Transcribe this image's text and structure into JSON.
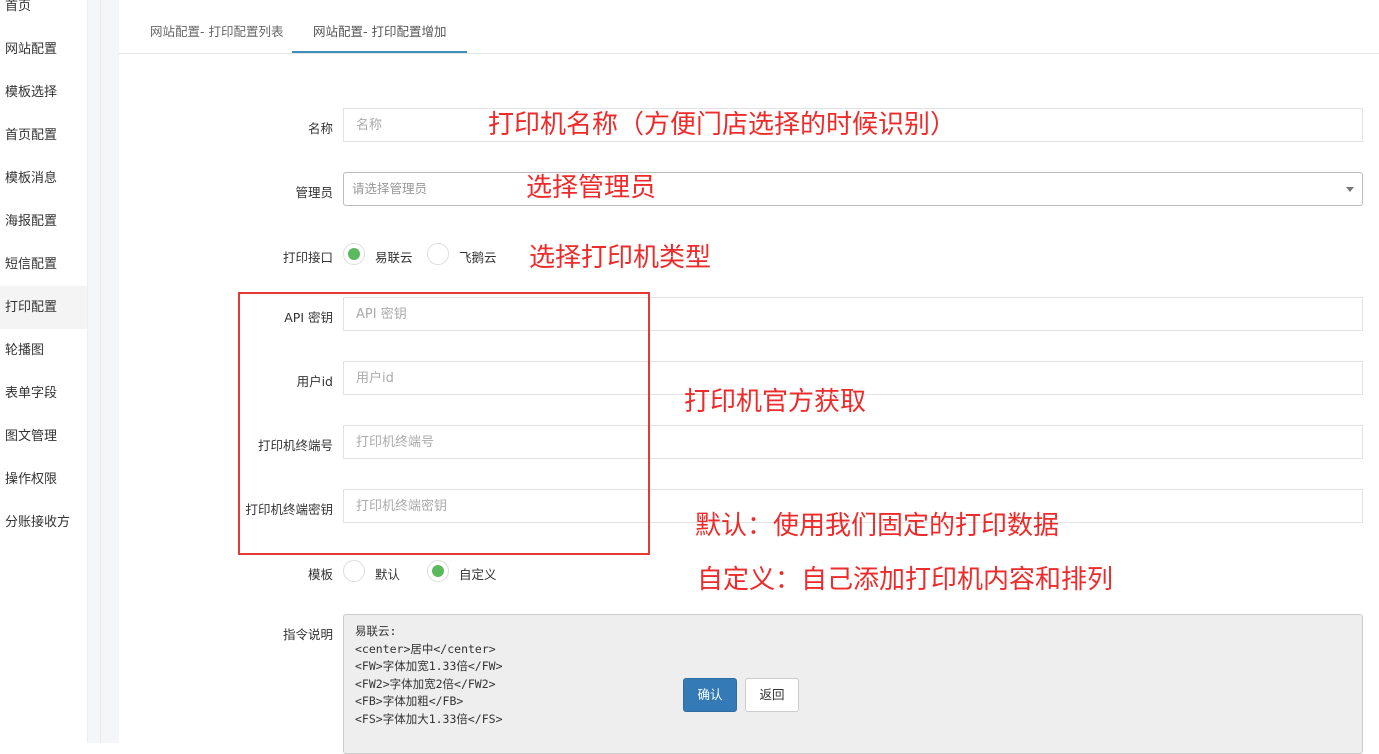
{
  "sidebar": {
    "items": [
      {
        "label": "首页"
      },
      {
        "label": "网站配置"
      },
      {
        "label": "模板选择"
      },
      {
        "label": "首页配置"
      },
      {
        "label": "模板消息"
      },
      {
        "label": "海报配置"
      },
      {
        "label": "短信配置"
      },
      {
        "label": "打印配置"
      },
      {
        "label": "轮播图"
      },
      {
        "label": "表单字段"
      },
      {
        "label": "图文管理"
      },
      {
        "label": "操作权限"
      },
      {
        "label": "分账接收方"
      }
    ]
  },
  "tabs": [
    {
      "label": "网站配置- 打印配置列表"
    },
    {
      "label": "网站配置- 打印配置增加"
    }
  ],
  "form": {
    "name": {
      "label": "名称",
      "placeholder": "名称"
    },
    "admin": {
      "label": "管理员",
      "placeholder": "请选择管理员"
    },
    "interface": {
      "label": "打印接口",
      "options": [
        "易联云",
        "飞鹅云"
      ],
      "selected": "易联云"
    },
    "api_key": {
      "label": "API 密钥",
      "placeholder": "API 密钥"
    },
    "user_id": {
      "label": "用户id",
      "placeholder": "用户id"
    },
    "terminal_no": {
      "label": "打印机终端号",
      "placeholder": "打印机终端号"
    },
    "terminal_key": {
      "label": "打印机终端密钥",
      "placeholder": "打印机终端密钥"
    },
    "template": {
      "label": "模板",
      "options": [
        "默认",
        "自定义"
      ],
      "selected": "自定义"
    },
    "instructions": {
      "label": "指令说明",
      "lines": [
        "易联云:",
        "<center>居中</center>",
        "<FW>字体加宽1.33倍</FW>",
        "<FW2>字体加宽2倍</FW2>",
        "<FB>字体加粗</FB>",
        "<FS>字体加大1.33倍</FS>"
      ]
    },
    "confirm_label": "确认",
    "back_label": "返回"
  },
  "annotations": {
    "name": "打印机名称（方便门店选择的时候识别）",
    "admin": "选择管理员",
    "interface": "选择打印机类型",
    "official": "打印机官方获取",
    "default": "默认：使用我们固定的打印数据",
    "custom": "自定义：自己添加打印机内容和排列"
  },
  "colors": {
    "annotation": "#ee2b2b",
    "primary": "#337ab7",
    "radio_checked": "#5cb85c",
    "tab_active": "#3c8dbc"
  }
}
